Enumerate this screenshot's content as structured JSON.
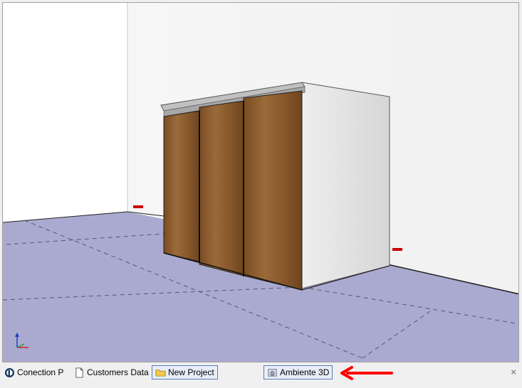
{
  "tabs": [
    {
      "label": "Conection P",
      "icon": "app-logo-icon",
      "active": false
    },
    {
      "label": "Customers Data",
      "icon": "document-icon",
      "active": false
    },
    {
      "label": "New Project",
      "icon": "folder-icon",
      "active": true
    },
    {
      "label": "Ambiente 3D",
      "icon": "3d-scene-icon",
      "active": true
    }
  ],
  "close_label": "×",
  "colors": {
    "floor": "#aaaad0",
    "wall_left": "#ffffff",
    "wall_back": "#f4f4f4",
    "cabinet_side": "#e2e2e2",
    "wood_door": "#8b5a2b",
    "rail": "#b8b8b8",
    "annotation_arrow": "#ff0000",
    "active_tab_border": "#5b7db6"
  },
  "icons": {
    "axis_gizmo": "xyz-axis-icon",
    "close": "close-icon",
    "annotation": "red-arrow-icon"
  }
}
